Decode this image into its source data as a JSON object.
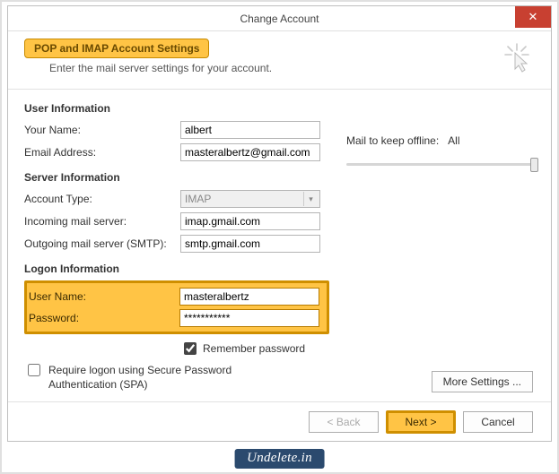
{
  "window": {
    "title": "Change Account",
    "headline": "POP and IMAP Account Settings",
    "subtitle": "Enter the mail server settings for your account."
  },
  "sections": {
    "user_info": "User Information",
    "server_info": "Server Information",
    "logon_info": "Logon Information"
  },
  "labels": {
    "your_name": "Your Name:",
    "email": "Email Address:",
    "account_type": "Account Type:",
    "incoming": "Incoming mail server:",
    "outgoing": "Outgoing mail server (SMTP):",
    "username": "User Name:",
    "password": "Password:",
    "remember": "Remember password",
    "spa": "Require logon using Secure Password Authentication (SPA)",
    "mail_keep": "Mail to keep offline:",
    "mail_keep_value": "All"
  },
  "values": {
    "your_name": "albert",
    "email": "masteralbertz@gmail.com",
    "account_type": "IMAP",
    "incoming": "imap.gmail.com",
    "outgoing": "smtp.gmail.com",
    "username": "masteralbertz",
    "password": "***********",
    "remember_checked": true,
    "spa_checked": false
  },
  "buttons": {
    "more_settings": "More Settings ...",
    "back": "< Back",
    "next": "Next >",
    "cancel": "Cancel"
  },
  "watermark": "Undelete.in"
}
